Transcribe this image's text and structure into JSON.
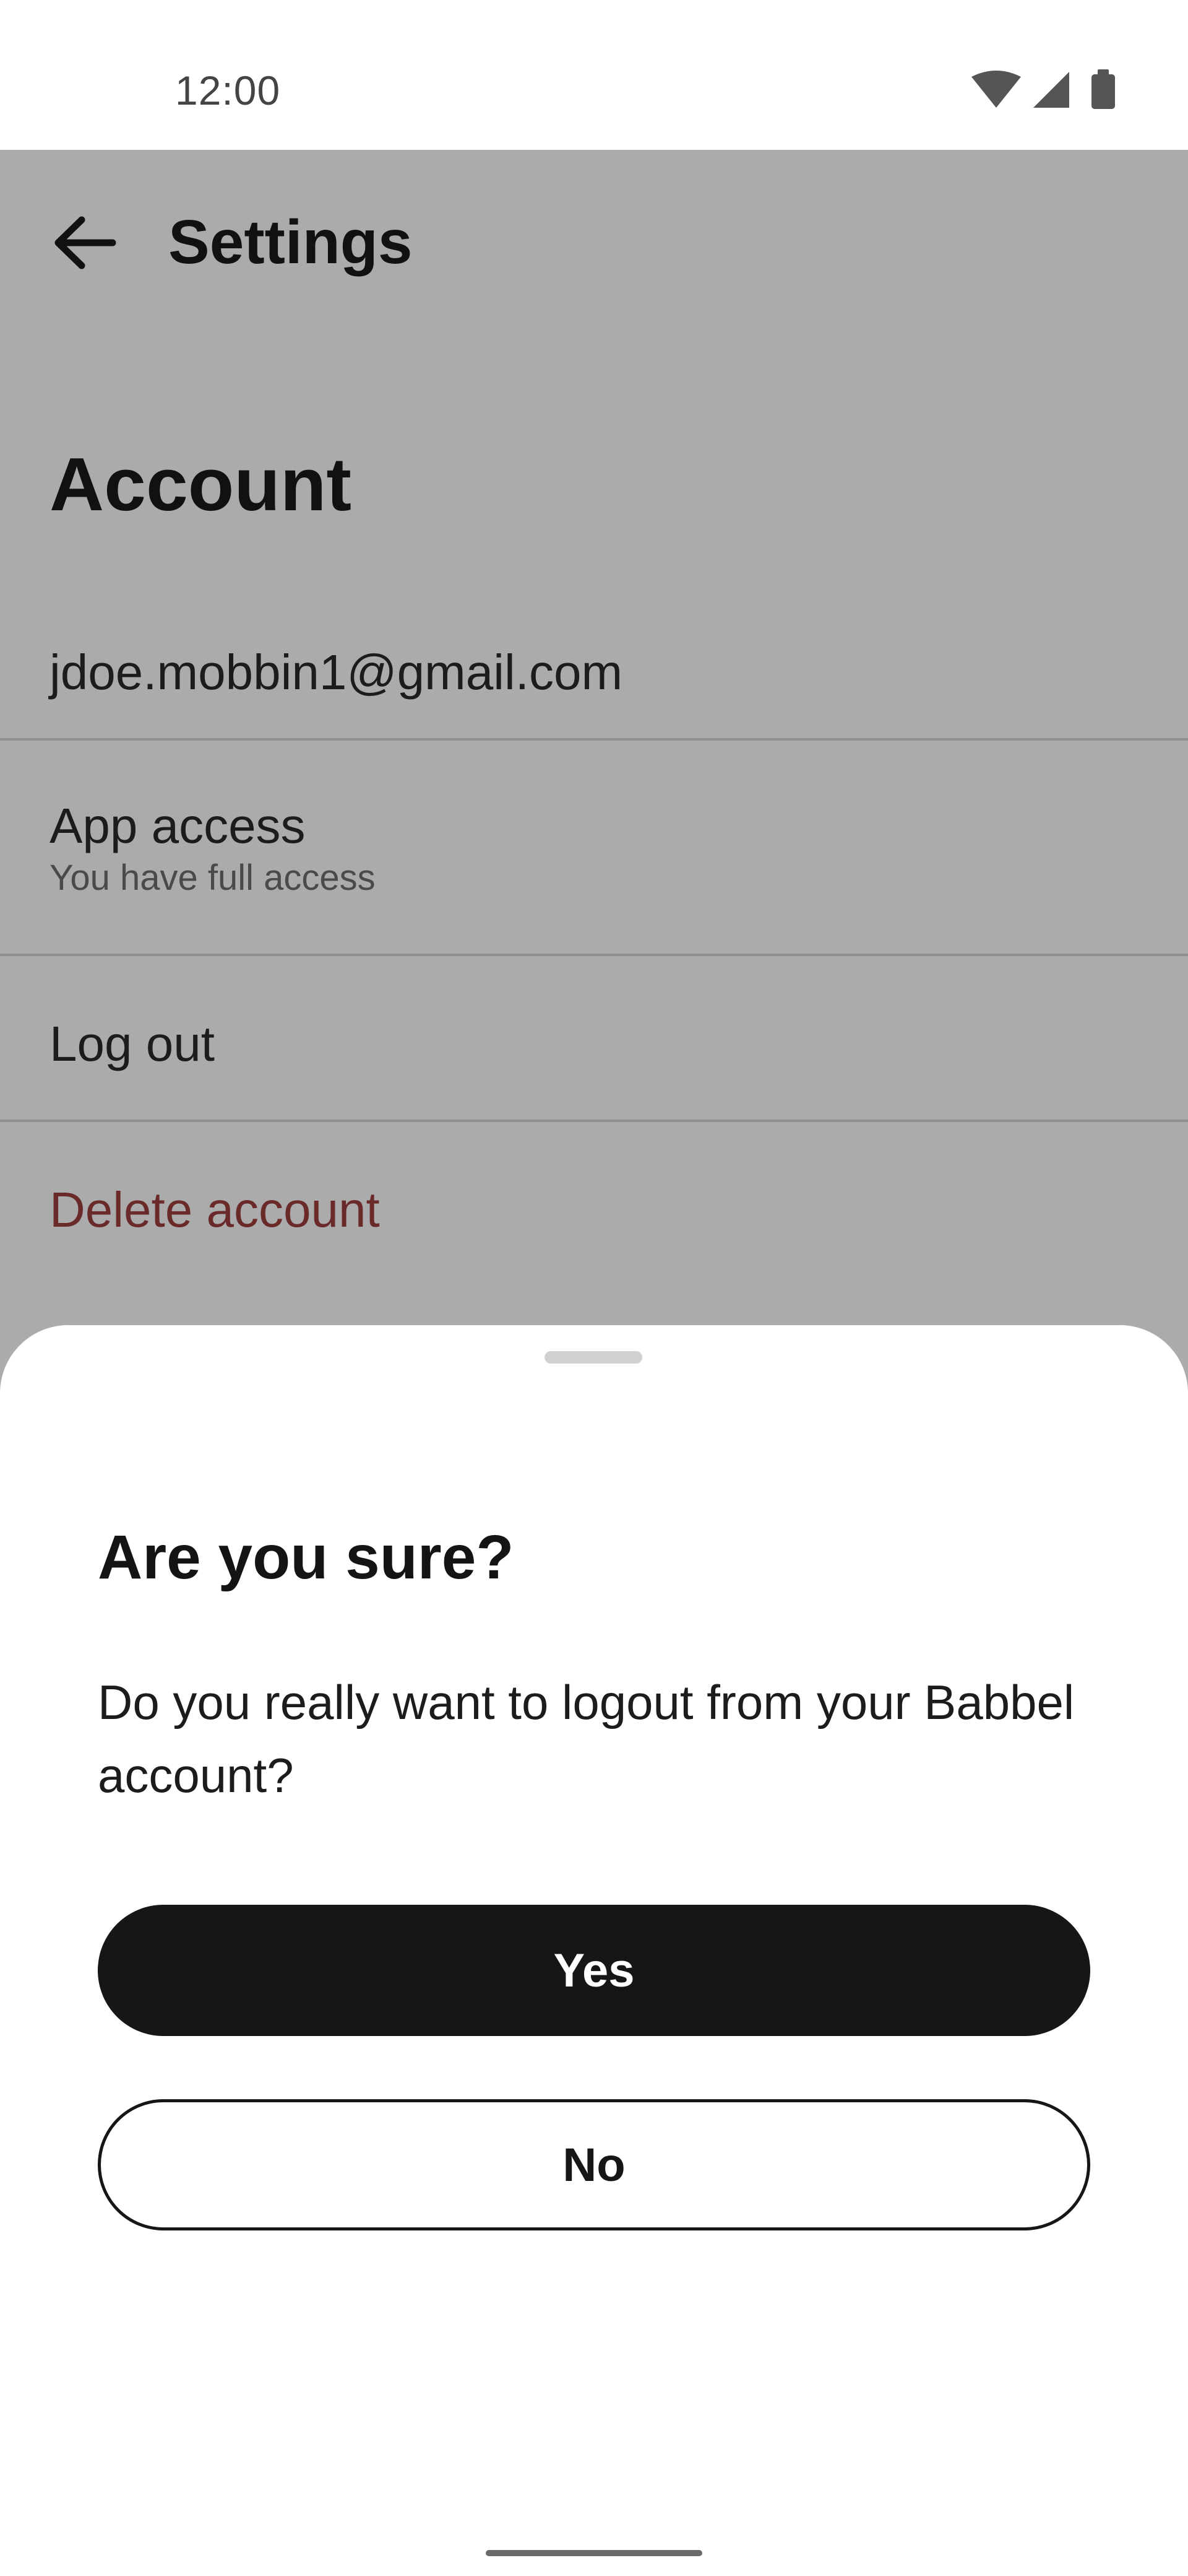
{
  "status_bar": {
    "time": "12:00",
    "icons": [
      "wifi-icon",
      "cellular-signal-icon",
      "battery-icon"
    ]
  },
  "app_bar": {
    "back_icon": "arrow-left-icon",
    "title": "Settings"
  },
  "account": {
    "section_title": "Account",
    "email": "jdoe.mobbin1@gmail.com",
    "app_access_label": "App access",
    "app_access_status": "You have full access",
    "logout_label": "Log out",
    "delete_label": "Delete account"
  },
  "dialog": {
    "title": "Are you sure?",
    "message": "Do you really want to logout from your Babbel account?",
    "yes_label": "Yes",
    "no_label": "No"
  },
  "colors": {
    "overlay": "#ababab",
    "primary_button": "#161616",
    "delete_text": "#6b2a2a",
    "sheet_background": "#ffffff"
  }
}
